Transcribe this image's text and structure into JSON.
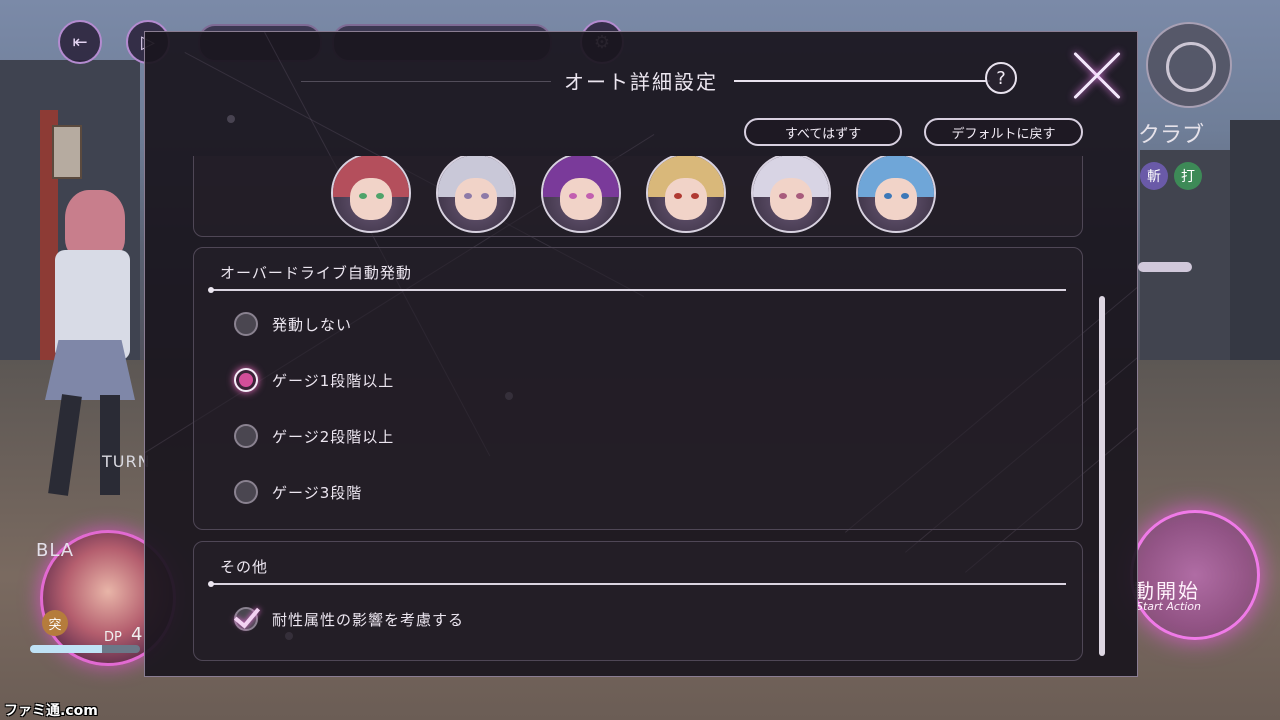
{
  "hud": {
    "turn_label": "TURN",
    "unit_label": "BLA",
    "attack_badge": "突",
    "dp_label": "DP",
    "dp_value": "4",
    "hp_fraction": 0.65,
    "club_label": "クラブ",
    "attr_slash": "斬",
    "attr_strike": "打",
    "start_button_jp": "動開始",
    "start_button_en": "Start Action",
    "watermark": "ファミ通.com"
  },
  "modal": {
    "title": "オート詳細設定",
    "help_label": "?",
    "clear_all_label": "すべてはずす",
    "reset_default_label": "デフォルトに戻す",
    "portraits": [
      {
        "name": "character-1",
        "hair": "#b44f5c",
        "eye": "#4fa36a"
      },
      {
        "name": "character-2",
        "hair": "#c9c8d8",
        "eye": "#8d7aa8"
      },
      {
        "name": "character-3",
        "hair": "#7a3a9a",
        "eye": "#c25fb0"
      },
      {
        "name": "character-4",
        "hair": "#d9b87a",
        "eye": "#b03a32"
      },
      {
        "name": "character-5",
        "hair": "#d8d4e4",
        "eye": "#a85b7c"
      },
      {
        "name": "character-6",
        "hair": "#6fa6d8",
        "eye": "#3c78b8"
      }
    ],
    "overdrive": {
      "heading": "オーバードライブ自動発動",
      "options": [
        {
          "label": "発動しない",
          "selected": false
        },
        {
          "label": "ゲージ1段階以上",
          "selected": true
        },
        {
          "label": "ゲージ2段階以上",
          "selected": false
        },
        {
          "label": "ゲージ3段階",
          "selected": false
        }
      ]
    },
    "other": {
      "heading": "その他",
      "consider_resistance_label": "耐性属性の影響を考慮する",
      "consider_resistance_checked": true
    }
  },
  "colors": {
    "accent_pink": "#d34e9a",
    "glow_pink": "#f07ae8"
  }
}
